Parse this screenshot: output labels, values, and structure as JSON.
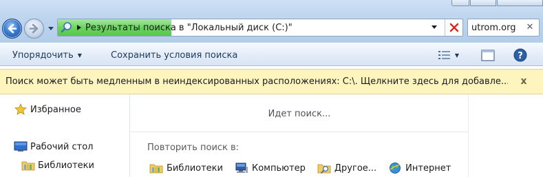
{
  "address_bar": {
    "path_text": "Результаты поиска в \"Локальный диск (C:)\"",
    "search_progress": 0.28
  },
  "search": {
    "value": "utrom.org",
    "clear_glyph": "✕"
  },
  "toolbar": {
    "organize_label": "Упорядочить",
    "save_search_label": "Сохранить условия поиска"
  },
  "info_bar": {
    "message": "Поиск может быть медленным в неиндексированных расположениях: C:\\. Щелкните здесь для добавле...",
    "close_glyph": "x"
  },
  "navigation": {
    "favorites_label": "Избранное",
    "desktop_label": "Рабочий стол",
    "libraries_label": "Библиотеки"
  },
  "results": {
    "status_text": "Идет поиск...",
    "repeat_label": "Повторить поиск в:",
    "locations": [
      {
        "label": "Библиотеки",
        "icon": "libraries-icon"
      },
      {
        "label": "Компьютер",
        "icon": "computer-icon"
      },
      {
        "label": "Другое...",
        "icon": "custom-folder-icon"
      },
      {
        "label": "Интернет",
        "icon": "internet-icon"
      }
    ]
  },
  "colors": {
    "info_bar_bg": "#fdf4be",
    "progress_green": "#6bd461",
    "toolbar_text": "#1e395b",
    "stop_red": "#d8261c"
  }
}
